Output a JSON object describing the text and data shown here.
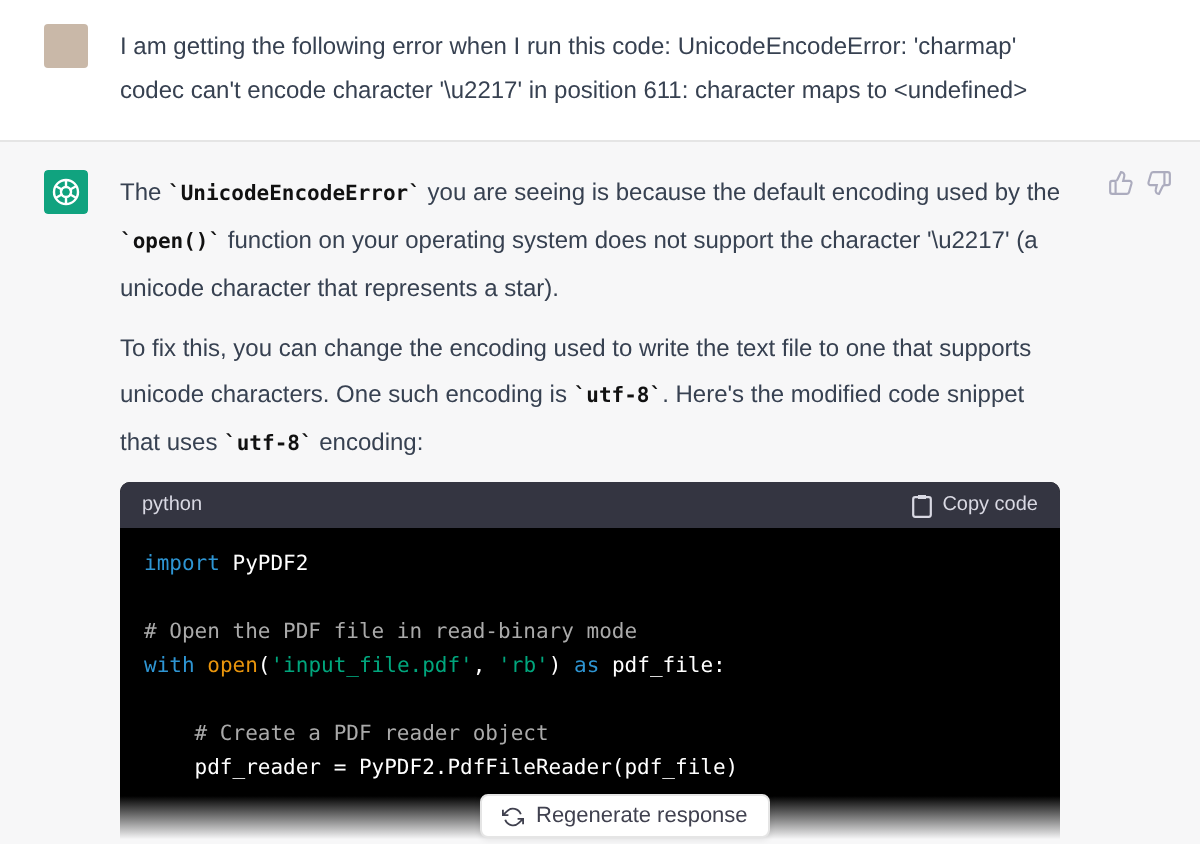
{
  "user_message": {
    "text": "I am getting the following error when I run this code: UnicodeEncodeError: 'charmap' codec can't encode character '\\u2217' in position 611: character maps to <undefined>"
  },
  "assistant_message": {
    "paragraphs": [
      "The **`UnicodeEncodeError`** you are seeing is because the default encoding used by the **`open()`** function on your operating system does not support the character '\\u2217' (a unicode character that represents a star).",
      "To fix this, you can change the encoding used to write the text file to one that supports unicode characters. One such encoding is **`utf-8`**. Here's the modified code snippet that uses **`utf-8`** encoding:"
    ],
    "code_block": {
      "language": "python",
      "copy_label": "Copy code",
      "lines": [
        {
          "kind": "code",
          "tokens": [
            {
              "kind": "keyword",
              "text": "import"
            },
            {
              "kind": "plain",
              "text": " PyPDF2"
            }
          ]
        },
        {
          "kind": "blank"
        },
        {
          "kind": "code",
          "tokens": [
            {
              "kind": "comment",
              "text": "# Open the PDF file in read-binary mode"
            }
          ]
        },
        {
          "kind": "code",
          "tokens": [
            {
              "kind": "keyword",
              "text": "with"
            },
            {
              "kind": "builtin",
              "text": " open"
            },
            {
              "kind": "plain",
              "text": "("
            },
            {
              "kind": "string",
              "text": "'input_file.pdf'"
            },
            {
              "kind": "plain",
              "text": ", "
            },
            {
              "kind": "string",
              "text": "'rb'"
            },
            {
              "kind": "plain",
              "text": ") "
            },
            {
              "kind": "keyword",
              "text": "as"
            },
            {
              "kind": "plain",
              "text": " pdf_file:"
            }
          ]
        },
        {
          "kind": "blank"
        },
        {
          "kind": "code",
          "tokens": [
            {
              "kind": "comment",
              "text": "    # Create a PDF reader object"
            }
          ]
        },
        {
          "kind": "code",
          "tokens": [
            {
              "kind": "plain",
              "text": "    pdf_reader = PyPDF2.PdfFileReader(pdf_file)"
            }
          ]
        }
      ]
    }
  },
  "regenerate_button": {
    "label": "Regenerate response"
  }
}
